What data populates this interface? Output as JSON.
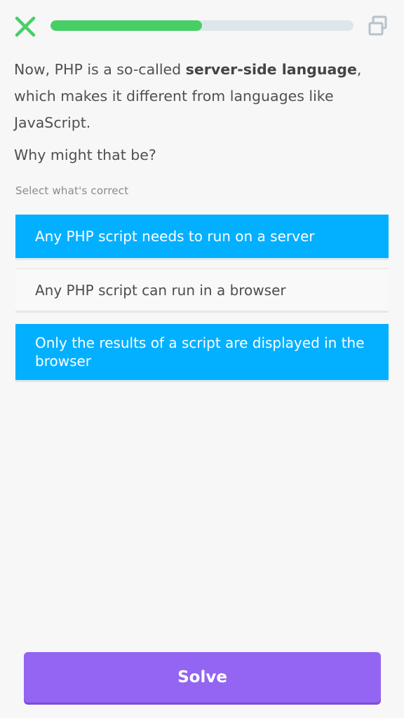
{
  "header": {
    "close_icon": "close-x-icon",
    "share_icon": "copy-share-icon",
    "progress_fraction": 0.5,
    "colors": {
      "close": "#47cf66",
      "progress_fill": "#47cf66",
      "progress_track": "#dde6e9",
      "share": "#b7c2c9"
    }
  },
  "question": {
    "intro_before": "Now, PHP is a so-called ",
    "intro_bold": "server-side language",
    "intro_after": ", which makes it different from languages like JavaScript.",
    "prompt": "Why might that be?"
  },
  "hint": "Select what's correct",
  "options": [
    {
      "label": "Any PHP script needs to run on a server",
      "selected": true
    },
    {
      "label": "Any PHP script can run in a browser",
      "selected": false
    },
    {
      "label": "Only the results of a script are displayed in the browser",
      "selected": true
    }
  ],
  "colors": {
    "option_selected": "#03b0ff",
    "solve_button": "#9365f2",
    "background": "#f7f7f7"
  },
  "solve_label": "Solve"
}
